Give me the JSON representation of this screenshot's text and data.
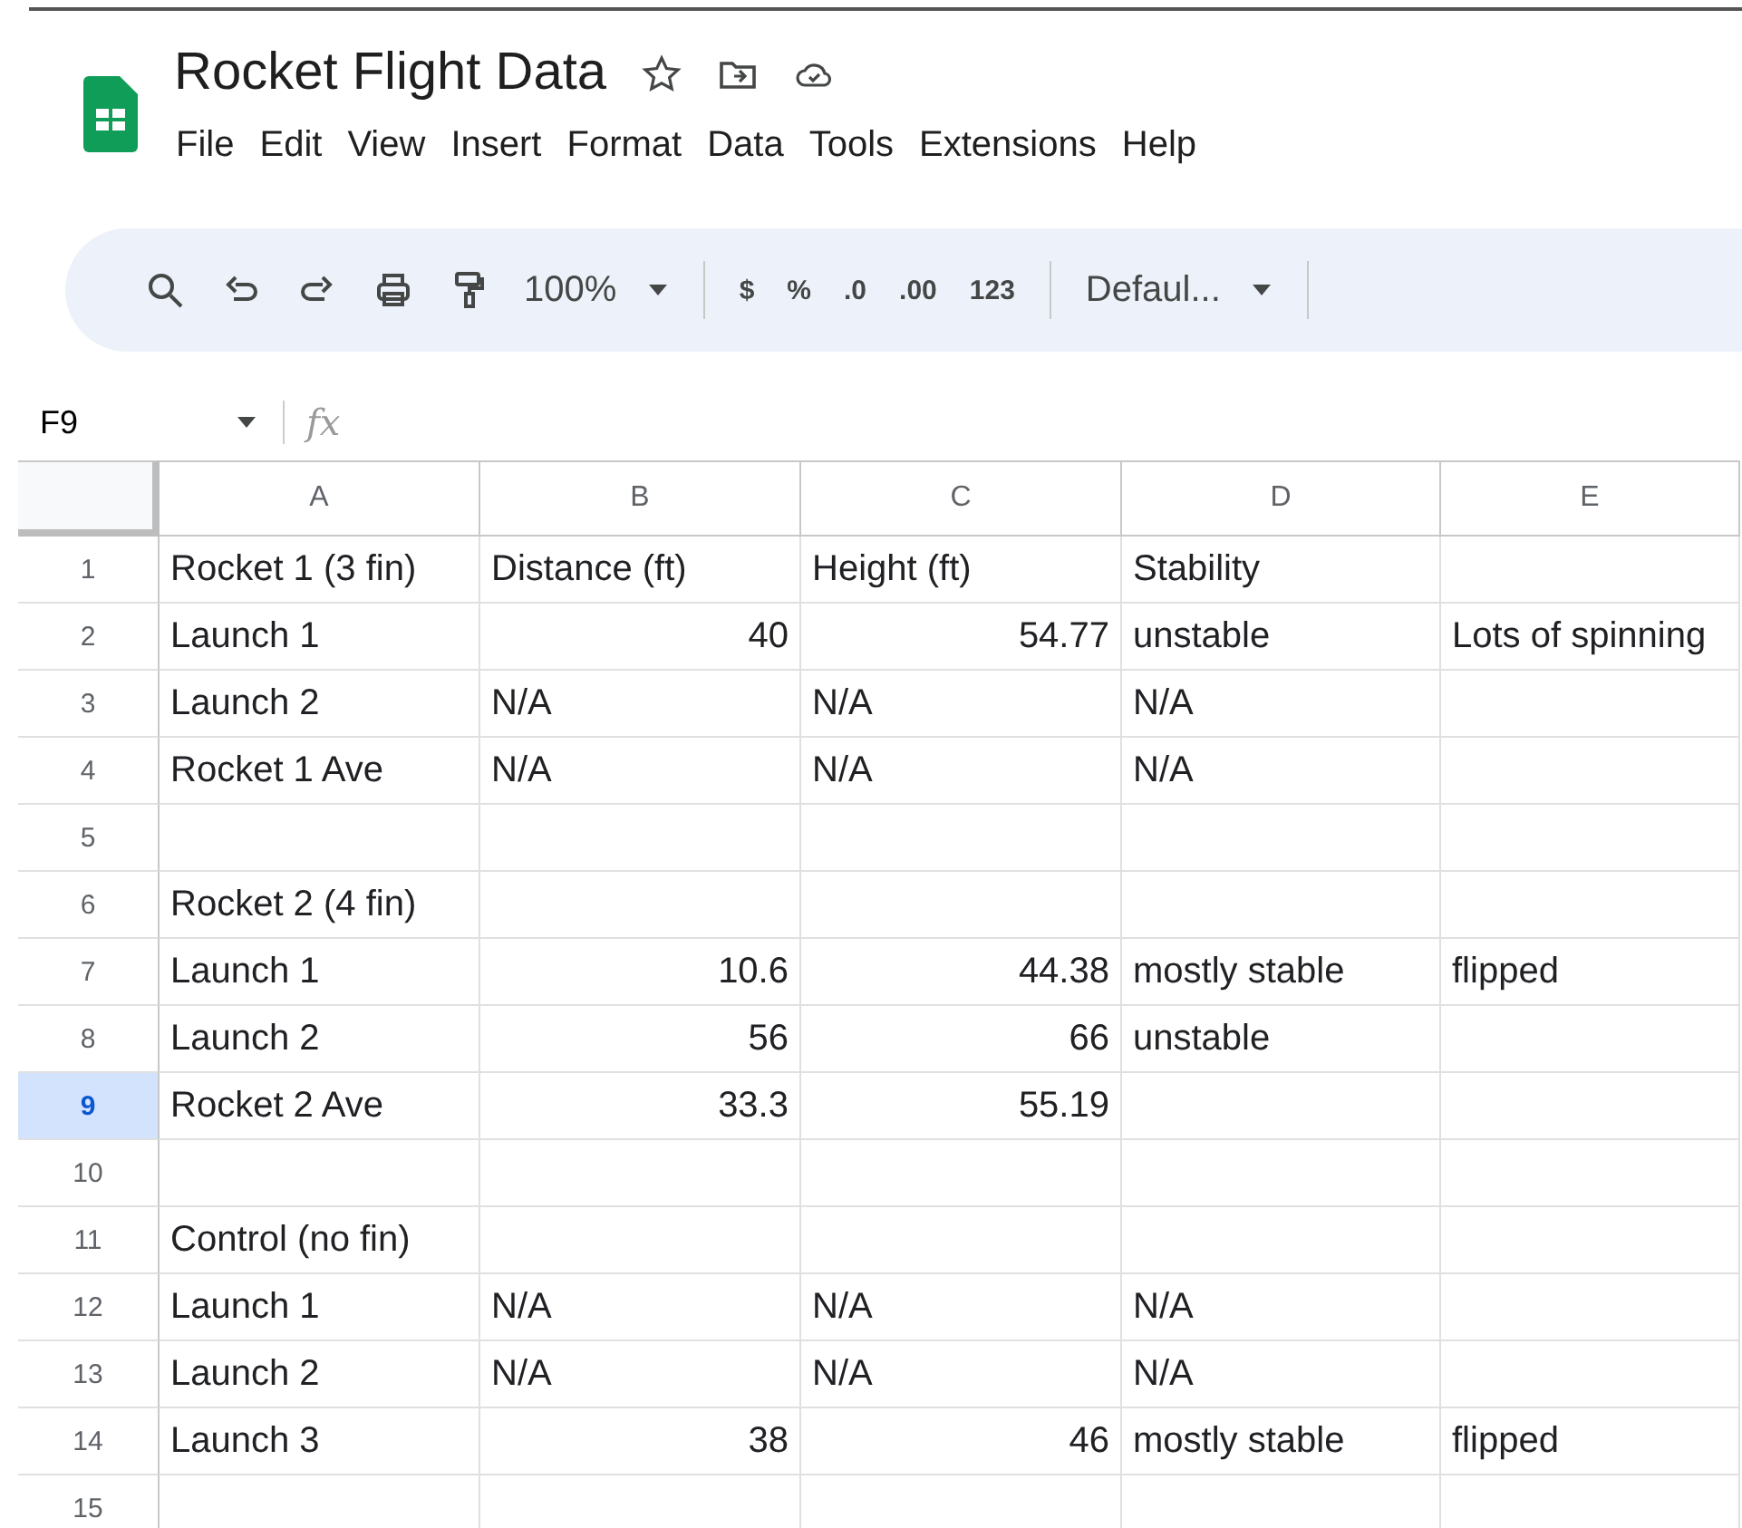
{
  "document": {
    "title": "Rocket Flight Data"
  },
  "menu": [
    "File",
    "Edit",
    "View",
    "Insert",
    "Format",
    "Data",
    "Tools",
    "Extensions",
    "Help"
  ],
  "toolbar": {
    "zoom": "100%",
    "currency": "$",
    "percent": "%",
    "decrease_decimals": ".0",
    "increase_decimals": ".00",
    "number_format": "123",
    "font": "Defaul..."
  },
  "formula_bar": {
    "cell_ref": "F9",
    "fx": "fx"
  },
  "columns": [
    "A",
    "B",
    "C",
    "D",
    "E"
  ],
  "rows": [
    {
      "number": "1",
      "selected": false,
      "cells": [
        {
          "text": "Rocket 1 (3 fin)",
          "kind": "text"
        },
        {
          "text": "Distance (ft)",
          "kind": "text"
        },
        {
          "text": "Height (ft)",
          "kind": "text"
        },
        {
          "text": "Stability",
          "kind": "text"
        },
        null
      ]
    },
    {
      "number": "2",
      "selected": false,
      "cells": [
        {
          "text": "Launch 1",
          "kind": "text"
        },
        {
          "text": "40",
          "kind": "number"
        },
        {
          "text": "54.77",
          "kind": "number"
        },
        {
          "text": "unstable",
          "kind": "text"
        },
        {
          "text": "Lots of spinning",
          "kind": "text"
        }
      ]
    },
    {
      "number": "3",
      "selected": false,
      "cells": [
        {
          "text": "Launch 2",
          "kind": "text"
        },
        {
          "text": "N/A",
          "kind": "text"
        },
        {
          "text": "N/A",
          "kind": "text"
        },
        {
          "text": "N/A",
          "kind": "text"
        },
        null
      ]
    },
    {
      "number": "4",
      "selected": false,
      "cells": [
        {
          "text": "Rocket 1 Ave",
          "kind": "text"
        },
        {
          "text": "N/A",
          "kind": "text"
        },
        {
          "text": "N/A",
          "kind": "text"
        },
        {
          "text": "N/A",
          "kind": "text"
        },
        null
      ]
    },
    {
      "number": "5",
      "selected": false,
      "cells": [
        null,
        null,
        null,
        null,
        null
      ]
    },
    {
      "number": "6",
      "selected": false,
      "cells": [
        {
          "text": "Rocket 2 (4 fin)",
          "kind": "text"
        },
        null,
        null,
        null,
        null
      ]
    },
    {
      "number": "7",
      "selected": false,
      "cells": [
        {
          "text": "Launch 1",
          "kind": "text"
        },
        {
          "text": "10.6",
          "kind": "number"
        },
        {
          "text": "44.38",
          "kind": "number"
        },
        {
          "text": "mostly stable",
          "kind": "text"
        },
        {
          "text": "flipped",
          "kind": "text"
        }
      ]
    },
    {
      "number": "8",
      "selected": false,
      "cells": [
        {
          "text": "Launch 2",
          "kind": "text"
        },
        {
          "text": "56",
          "kind": "number"
        },
        {
          "text": "66",
          "kind": "number"
        },
        {
          "text": "unstable",
          "kind": "text"
        },
        null
      ]
    },
    {
      "number": "9",
      "selected": true,
      "cells": [
        {
          "text": "Rocket 2 Ave",
          "kind": "text"
        },
        {
          "text": "33.3",
          "kind": "number"
        },
        {
          "text": "55.19",
          "kind": "number"
        },
        null,
        null
      ]
    },
    {
      "number": "10",
      "selected": false,
      "cells": [
        null,
        null,
        null,
        null,
        null
      ]
    },
    {
      "number": "11",
      "selected": false,
      "cells": [
        {
          "text": "Control (no fin)",
          "kind": "text"
        },
        null,
        null,
        null,
        null
      ]
    },
    {
      "number": "12",
      "selected": false,
      "cells": [
        {
          "text": "Launch 1",
          "kind": "text"
        },
        {
          "text": "N/A",
          "kind": "text"
        },
        {
          "text": "N/A",
          "kind": "text"
        },
        {
          "text": "N/A",
          "kind": "text"
        },
        null
      ]
    },
    {
      "number": "13",
      "selected": false,
      "cells": [
        {
          "text": "Launch 2",
          "kind": "text"
        },
        {
          "text": "N/A",
          "kind": "text"
        },
        {
          "text": "N/A",
          "kind": "text"
        },
        {
          "text": "N/A",
          "kind": "text"
        },
        null
      ]
    },
    {
      "number": "14",
      "selected": false,
      "cells": [
        {
          "text": "Launch 3",
          "kind": "text"
        },
        {
          "text": "38",
          "kind": "number"
        },
        {
          "text": "46",
          "kind": "number"
        },
        {
          "text": "mostly stable",
          "kind": "text"
        },
        {
          "text": "flipped",
          "kind": "text"
        }
      ]
    },
    {
      "number": "15",
      "selected": false,
      "cells": [
        null,
        null,
        null,
        null,
        null
      ]
    }
  ]
}
